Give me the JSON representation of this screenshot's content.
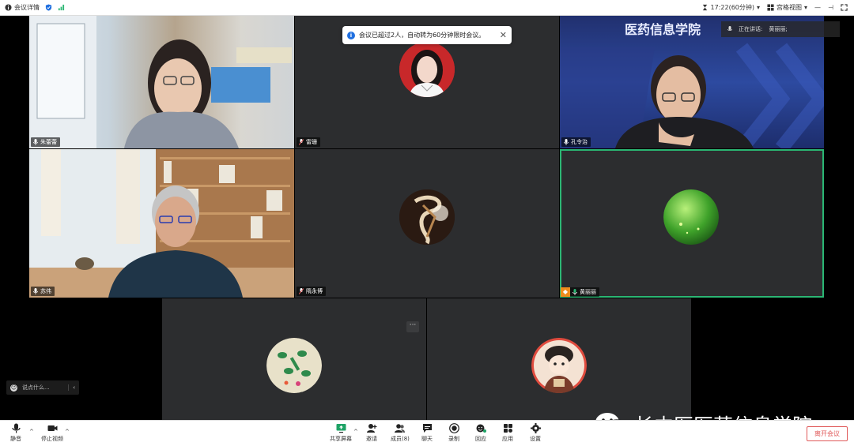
{
  "topbar": {
    "meeting_details": "会议详情",
    "time": "17:22(60分钟)",
    "view_mode": "宫格视图"
  },
  "notice": {
    "text": "会议已超过2人，自动转为60分钟限时会议。"
  },
  "speaking": {
    "label": "正在讲话:",
    "name": "黄丽丽;"
  },
  "banner_text": "医药信息学院",
  "participants": [
    {
      "name": "朱蕾蕾",
      "kind": "video"
    },
    {
      "name": "雷珊",
      "kind": "avatar"
    },
    {
      "name": "孔令治",
      "kind": "video"
    },
    {
      "name": "苏伟",
      "kind": "video"
    },
    {
      "name": "隋永博",
      "kind": "avatar"
    },
    {
      "name": "黄丽丽",
      "kind": "avatar"
    },
    {
      "name": "",
      "kind": "avatar"
    },
    {
      "name": "",
      "kind": "avatar"
    }
  ],
  "chat": {
    "placeholder": "说点什么..."
  },
  "watermark": "长中医医药信息学院",
  "toolbar": {
    "mute": "静音",
    "stop_video": "停止视频",
    "share": "共享屏幕",
    "invite": "邀请",
    "members": "成员(8)",
    "chat": "聊天",
    "record": "录制",
    "replay": "回应",
    "apps": "应用",
    "settings": "设置",
    "leave": "离开会议"
  },
  "colors": {
    "active_border": "#2bb673",
    "leave_red": "#e05a5a",
    "tile_bg": "#2c2d2f"
  }
}
